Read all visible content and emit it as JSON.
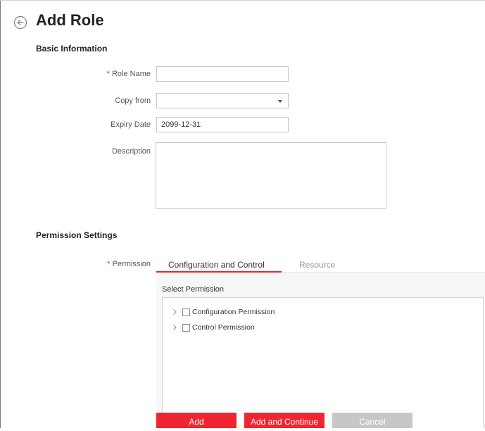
{
  "page": {
    "title": "Add Role"
  },
  "basic_info": {
    "heading": "Basic Information",
    "role_name": {
      "label": "Role Name",
      "required_mark": "*",
      "value": ""
    },
    "copy_from": {
      "label": "Copy from",
      "value": ""
    },
    "expiry_date": {
      "label": "Expiry Date",
      "value": "2099-12-31"
    },
    "description": {
      "label": "Description",
      "value": ""
    }
  },
  "permission_settings": {
    "heading": "Permission Settings",
    "permission_label": "Permission",
    "required_mark": "*",
    "tabs": [
      {
        "label": "Configuration and Control",
        "active": true
      },
      {
        "label": "Resource",
        "active": false
      }
    ],
    "select_heading": "Select Permission",
    "tree": [
      {
        "label": "Configuration Permission",
        "checked": false
      },
      {
        "label": "Control Permission",
        "checked": false
      }
    ]
  },
  "buttons": {
    "add": "Add",
    "add_continue": "Add and Continue",
    "cancel": "Cancel"
  },
  "colors": {
    "accent": "#ee2631",
    "required": "#e8262d",
    "cancel": "#c7c7c7"
  }
}
